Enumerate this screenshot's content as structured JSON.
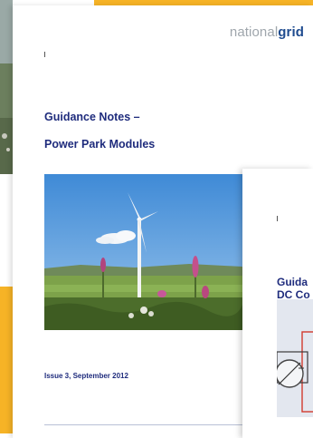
{
  "brand": {
    "prefix": "national",
    "suffix": "grid"
  },
  "main_document": {
    "title_line_1": "Guidance Notes –",
    "title_line_2": "Power Park Modules",
    "issue": "Issue 3, September 2012",
    "photo": "wind-turbine-landscape"
  },
  "second_document": {
    "title_line_1": "Guida",
    "title_line_2": "DC Co",
    "diagram": "converter-diagram"
  },
  "colors": {
    "accent": "#f6b326",
    "title_blue": "#1f2c7d",
    "brand_gray": "#9fa6ac",
    "brand_blue": "#1e4b8f",
    "diagram_red": "#d23a2e"
  }
}
